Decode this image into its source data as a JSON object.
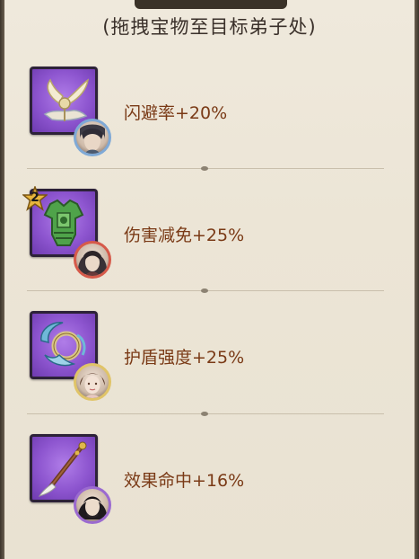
{
  "subtitle": "(拖拽宝物至目标弟子处)",
  "treasures": [
    {
      "icon": "winged-ornament-icon",
      "stat": "闪避率+20%",
      "avatar_border": "#7fa9d6",
      "star": null
    },
    {
      "icon": "jade-armor-icon",
      "stat": "伤害减免+25%",
      "avatar_border": "#d65a4a",
      "star": "2"
    },
    {
      "icon": "cloud-ring-icon",
      "stat": "护盾强度+25%",
      "avatar_border": "#e0c468",
      "star": null
    },
    {
      "icon": "brush-staff-icon",
      "stat": "效果命中+16%",
      "avatar_border": "#9b6ad0",
      "star": null
    }
  ]
}
